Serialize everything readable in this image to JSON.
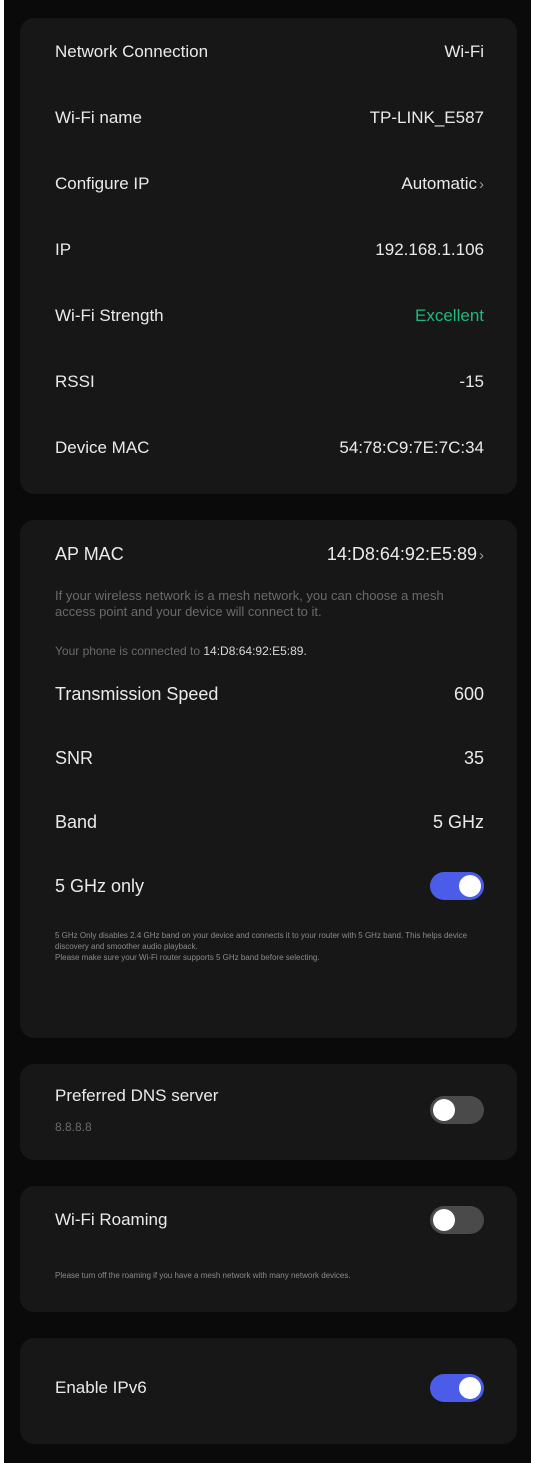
{
  "connection_card": {
    "rows": [
      {
        "label": "Network Connection",
        "value": "Wi-Fi"
      },
      {
        "label": "Wi-Fi name",
        "value": "TP-LINK_E587"
      },
      {
        "label": "Configure IP",
        "value": "Automatic",
        "chevron": "›"
      },
      {
        "label": "IP",
        "value": "192.168.1.106"
      },
      {
        "label": "Wi-Fi Strength",
        "value": "Excellent",
        "value_color": "#1fb87e"
      },
      {
        "label": "RSSI",
        "value": "-15"
      },
      {
        "label": "Device MAC",
        "value": "54:78:C9:7E:7C:34"
      }
    ]
  },
  "ap_card": {
    "ap_mac": {
      "label": "AP MAC",
      "value": "14:D8:64:92:E5:89",
      "chevron": "›"
    },
    "mesh_description": "If your wireless network is a mesh network, you can choose a mesh access point and your device will connect to it.",
    "connected_prefix": "Your phone is connected to",
    "connected_mac": "14:D8:64:92:E5:89.",
    "transmission_speed": {
      "label": "Transmission Speed",
      "value": "600"
    },
    "snr": {
      "label": "SNR",
      "value": "35"
    },
    "band": {
      "label": "Band",
      "value": "5 GHz"
    },
    "five_ghz_only": {
      "label": "5 GHz only",
      "enabled": true
    },
    "note_line1": "5 GHz Only disables 2.4 GHz band on your device and connects it to your router with 5 GHz band. This helps device discovery and smoother audio playback.",
    "note_line2": "Please make sure your Wi-Fi router supports 5 GHz band before selecting."
  },
  "dns_card": {
    "label": "Preferred DNS server",
    "value": "8.8.8.8",
    "enabled": false
  },
  "roaming_card": {
    "label": "Wi-Fi Roaming",
    "enabled": false,
    "note": "Please turn off the roaming if you have a mesh network with many network devices."
  },
  "ipv6_card": {
    "label": "Enable IPv6",
    "enabled": true
  },
  "colors": {
    "background": "#0a0a0a",
    "card": "#171717",
    "toggle_on": "#4b5ce8",
    "toggle_off": "#4a4a4a",
    "excellent": "#1fb87e"
  }
}
